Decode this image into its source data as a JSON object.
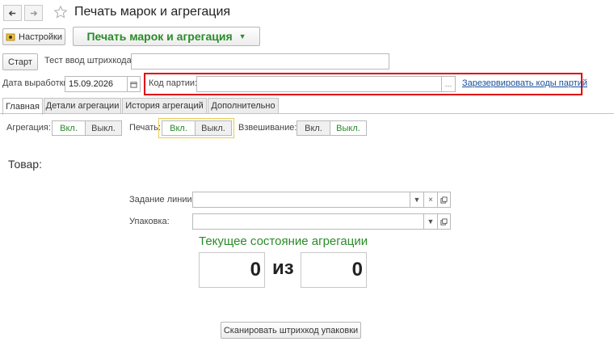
{
  "window": {
    "title": "Печать марок и агрегация"
  },
  "toolbar": {
    "settings_label": "Настройки",
    "main_button_label": "Печать марок и агрегация"
  },
  "form": {
    "start_label": "Старт",
    "test_barcode_label": "Тест ввод штрихкода:",
    "test_barcode_value": "",
    "production_date_label": "Дата выработки:",
    "production_date_value": "15.09.2026",
    "batch_code_label": "Код партии:",
    "batch_code_value": "",
    "reserve_link": "Зарезервировать коды партий"
  },
  "tabs": [
    {
      "label": "Главная",
      "active": true
    },
    {
      "label": "Детали агрегации",
      "active": false
    },
    {
      "label": "История агрегаций",
      "active": false
    },
    {
      "label": "Дополнительно",
      "active": false
    }
  ],
  "toggles": {
    "aggregation": {
      "label": "Агрегация:",
      "on": "Вкл.",
      "off": "Выкл."
    },
    "print": {
      "label": "Печать:",
      "on": "Вкл.",
      "off": "Выкл."
    },
    "weighing": {
      "label": "Взвешивание:",
      "on": "Вкл.",
      "off": "Выкл."
    }
  },
  "main": {
    "goods_heading": "Товар:",
    "line_task_label": "Задание линии:",
    "line_task_value": "",
    "package_label": "Упаковка:",
    "package_value": "",
    "state_title": "Текущее состояние агрегации",
    "current_count": "0",
    "of_text": "из",
    "total_count": "0",
    "scan_button_label": "Сканировать штрихкод упаковки"
  },
  "colors": {
    "accent_green": "#2a8b2a",
    "highlight_red": "#e00000",
    "link_blue": "#1a4f9c"
  }
}
